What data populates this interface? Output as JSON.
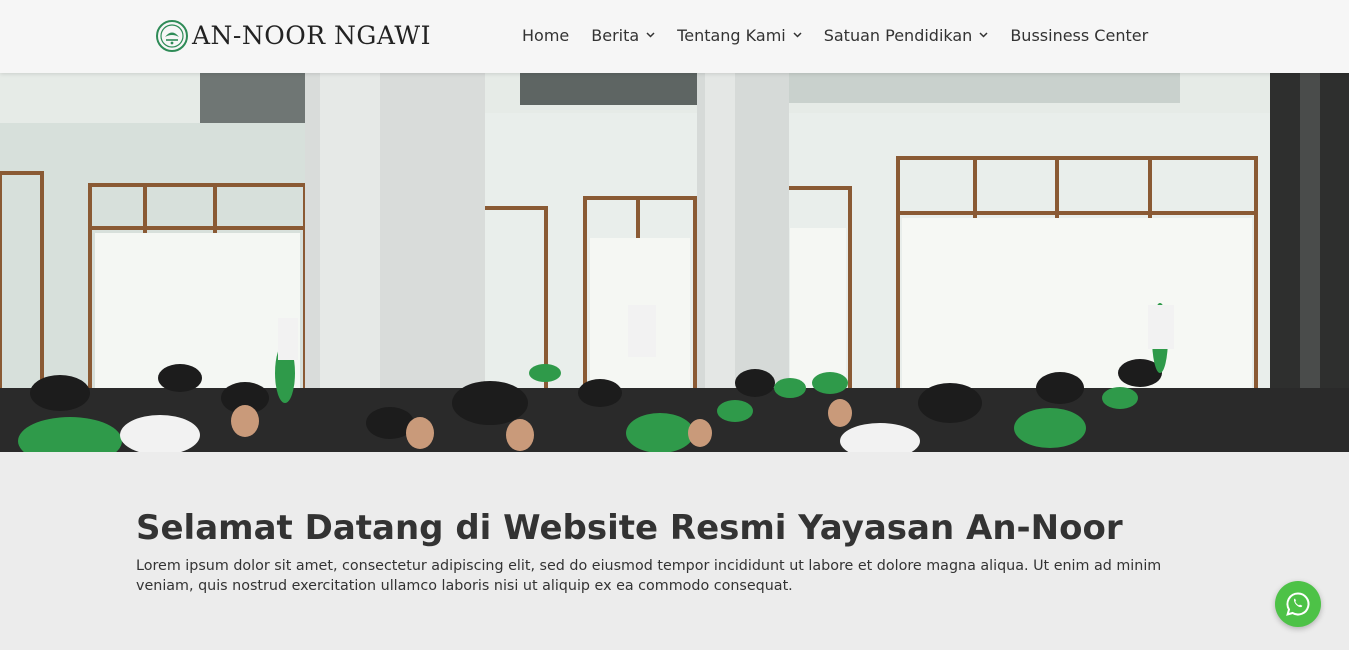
{
  "header": {
    "logo_text": "AN-NOOR NGAWI",
    "nav": [
      {
        "label": "Home",
        "dropdown": false
      },
      {
        "label": "Berita",
        "dropdown": true
      },
      {
        "label": "Tentang Kami",
        "dropdown": true
      },
      {
        "label": "Satuan Pendidikan",
        "dropdown": true
      },
      {
        "label": "Bussiness Center",
        "dropdown": false
      }
    ]
  },
  "hero": {
    "image": "photo-students-in-mosque-hall"
  },
  "main": {
    "title": "Selamat Datang di Website Resmi Yayasan An-Noor",
    "lead": "Lorem ipsum dolor sit amet, consectetur adipiscing elit, sed do eiusmod tempor incididunt ut labore et dolore magna aliqua. Ut enim ad minim veniam, quis nostrud exercitation ullamco laboris nisi ut aliquip ex ea commodo consequat."
  },
  "floating": {
    "icon": "whatsapp-icon"
  },
  "colors": {
    "brand_green": "#2e8b57",
    "header_bg": "#f6f6f6",
    "page_bg": "#ececec",
    "whatsapp": "#4dc247",
    "text": "#333333"
  }
}
